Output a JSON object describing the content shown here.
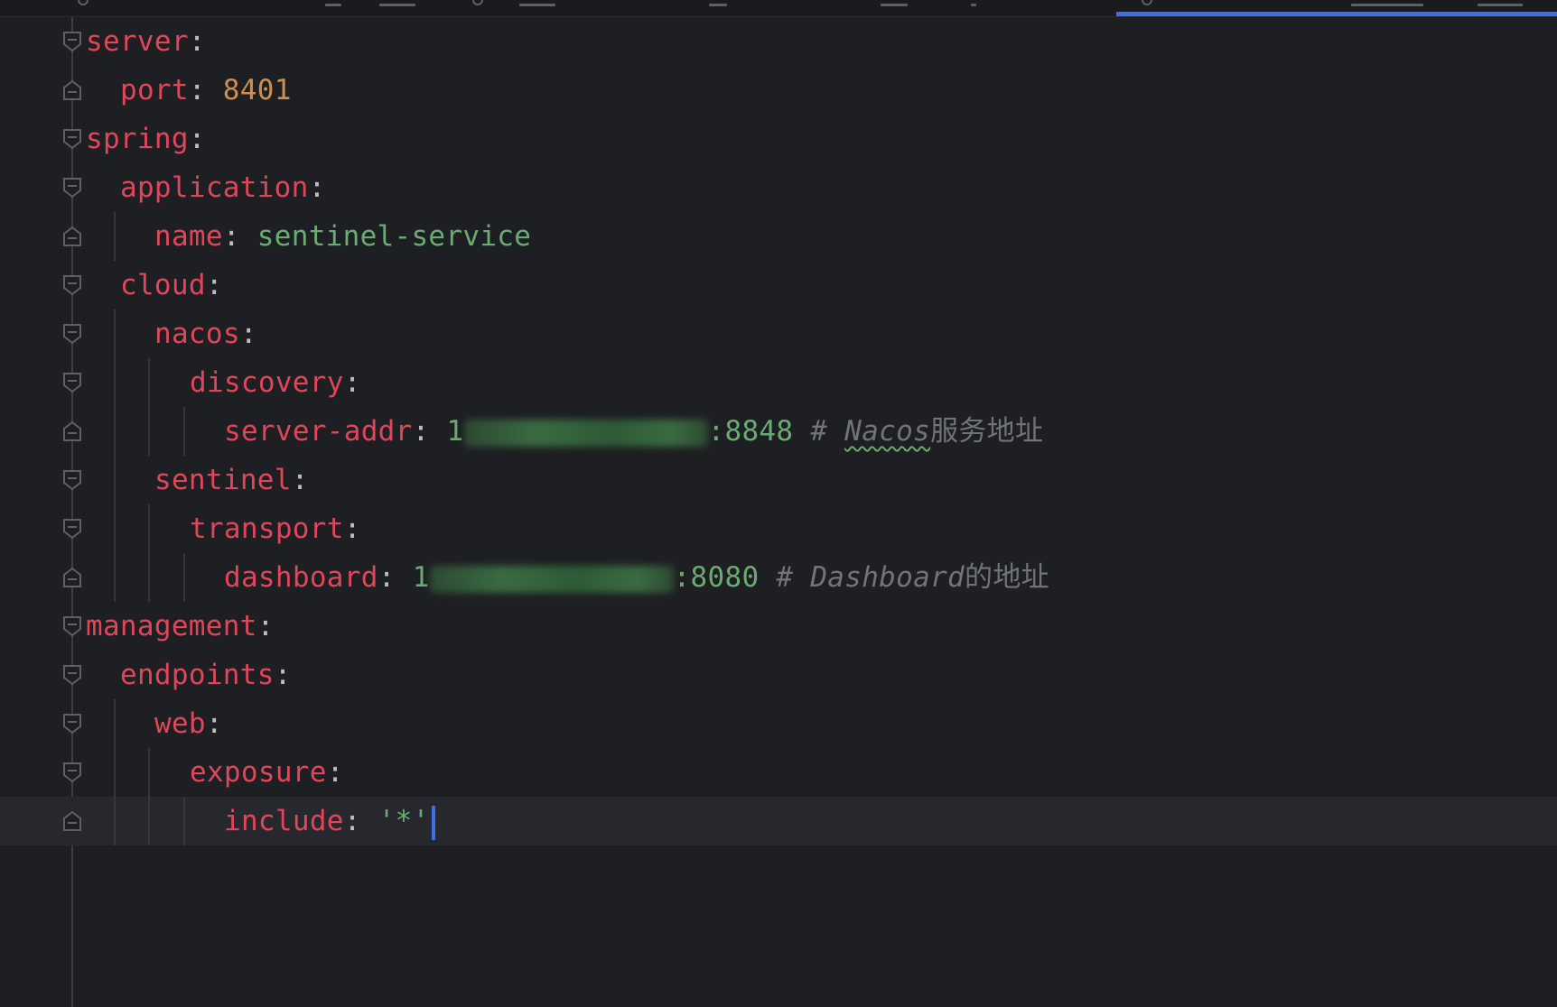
{
  "editor": {
    "colors": {
      "background": "#1e1f22",
      "key": "#e0455a",
      "number": "#cf8e4f",
      "string": "#6aab73",
      "comment": "#6f737a",
      "active_tab_indicator": "#3d6fea"
    },
    "lines": [
      {
        "key": "server",
        "sep": ":"
      },
      {
        "key": "port",
        "sep": ": ",
        "value": "8401"
      },
      {
        "key": "spring",
        "sep": ":"
      },
      {
        "key": "application",
        "sep": ":"
      },
      {
        "key": "name",
        "sep": ": ",
        "value": "sentinel-service"
      },
      {
        "key": "cloud",
        "sep": ":"
      },
      {
        "key": "nacos",
        "sep": ":"
      },
      {
        "key": "discovery",
        "sep": ":"
      },
      {
        "key": "server-addr",
        "sep": ": ",
        "value_prefix": "1",
        "value_suffix": ":8848",
        "comment_hash": "# ",
        "comment_word": "Nacos",
        "comment_tail": "服务地址"
      },
      {
        "key": "sentinel",
        "sep": ":"
      },
      {
        "key": "transport",
        "sep": ":"
      },
      {
        "key": "dashboard",
        "sep": ": ",
        "value_prefix": "1",
        "value_suffix": ":8080",
        "comment_hash": "# ",
        "comment_word": "Dashboard",
        "comment_tail": "的地址"
      },
      {
        "key": "management",
        "sep": ":"
      },
      {
        "key": "endpoints",
        "sep": ":"
      },
      {
        "key": "web",
        "sep": ":"
      },
      {
        "key": "exposure",
        "sep": ":"
      },
      {
        "key": "include",
        "sep": ": ",
        "value": "'*'"
      }
    ]
  }
}
